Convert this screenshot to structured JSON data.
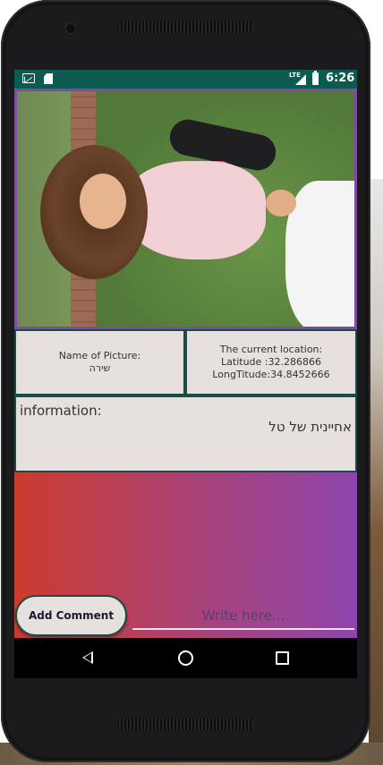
{
  "status_bar": {
    "network": "LTE",
    "time": "6:26",
    "icons": [
      "gmail-icon",
      "sd-card-icon",
      "signal-icon",
      "battery-icon"
    ]
  },
  "photo": {
    "description_icon": "photo"
  },
  "picture_info": {
    "name_label": "Name of Picture:",
    "name_value": "שירה"
  },
  "location": {
    "label": "The current location:",
    "latitude": "Latitude :32.286866",
    "longitude": "LongTitude:34.8452666"
  },
  "information": {
    "label": "information:",
    "value": "אחיינית של טל"
  },
  "comment": {
    "button_label": "Add Comment",
    "placeholder": "Write here..."
  },
  "colors": {
    "status_bar": "#0d5a50",
    "gradient_left": "#cc3b2f",
    "gradient_right": "#8e44ad",
    "box_background": "#e6e0de",
    "box_border": "#1b4d45"
  }
}
